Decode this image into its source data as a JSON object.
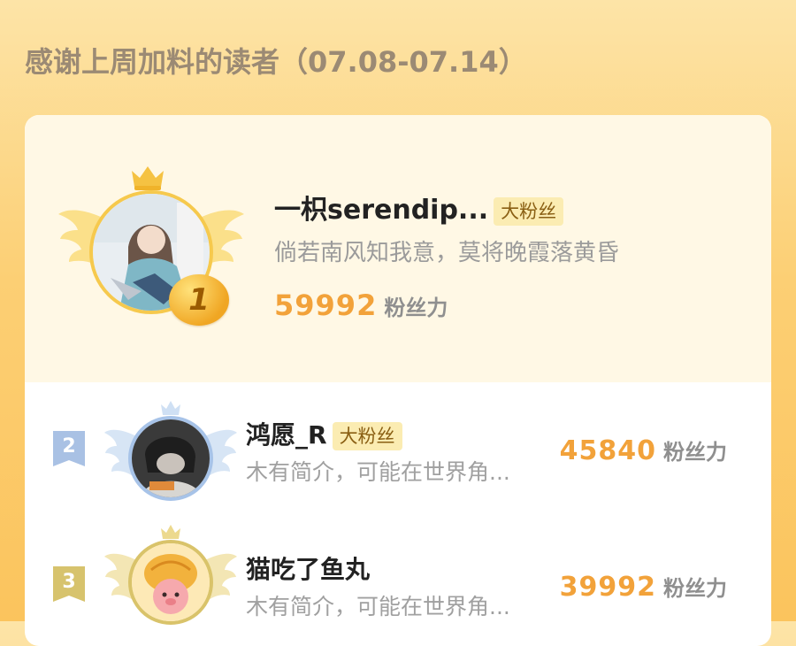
{
  "header": {
    "title": "感谢上周加料的读者（07.08-07.14）"
  },
  "fan_badge": "大粉丝",
  "score_unit": "粉丝力",
  "entries": [
    {
      "rank": "1",
      "name": "一枳serendip...",
      "badge": "大粉丝",
      "bio": "倘若南风知我意，莫将晚霞落黄昏",
      "score": "59992"
    },
    {
      "rank": "2",
      "name": "鸿愿_R",
      "badge": "大粉丝",
      "bio": "木有简介，可能在世界角...",
      "score": "45840"
    },
    {
      "rank": "3",
      "name": "猫吃了鱼丸",
      "badge": "",
      "bio": "木有简介，可能在世界角...",
      "score": "39992"
    }
  ],
  "colors": {
    "score": "#f2a23a",
    "gold": "#f6c94d",
    "silver": "#a7c3e8",
    "bronze": "#d9c36a"
  }
}
